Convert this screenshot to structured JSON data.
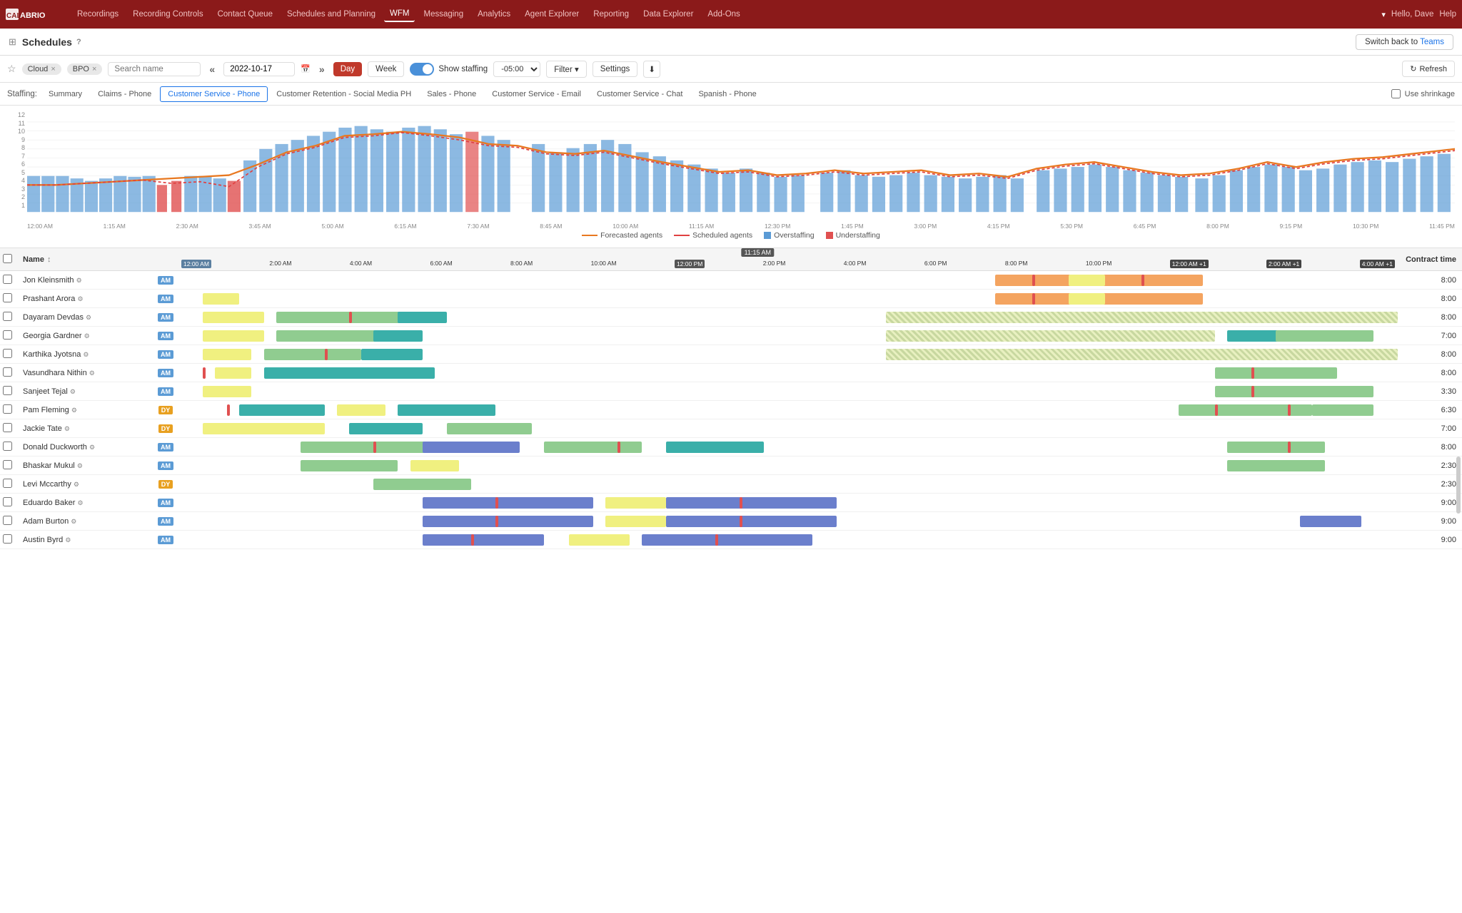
{
  "app": {
    "logo": "CALABRIO",
    "nav_items": [
      {
        "label": "Recordings",
        "active": false
      },
      {
        "label": "Recording Controls",
        "active": false
      },
      {
        "label": "Contact Queue",
        "active": false
      },
      {
        "label": "Schedules and Planning",
        "active": false
      },
      {
        "label": "WFM",
        "active": true
      },
      {
        "label": "Messaging",
        "active": false
      },
      {
        "label": "Analytics",
        "active": false
      },
      {
        "label": "Agent Explorer",
        "active": false
      },
      {
        "label": "Reporting",
        "active": false
      },
      {
        "label": "Data Explorer",
        "active": false
      },
      {
        "label": "Add-Ons",
        "active": false
      }
    ],
    "user": "Hello, Dave",
    "help": "Help",
    "switch_teams": "Switch back to Teams"
  },
  "toolbar": {
    "title": "Schedules",
    "help_icon": "?"
  },
  "filter_bar": {
    "tags": [
      "Cloud",
      "BPO"
    ],
    "search_placeholder": "Search name",
    "date": "2022-10-17",
    "day_label": "Day",
    "week_label": "Week",
    "show_staffing": "Show staffing",
    "timezone": "-05:00",
    "filter_label": "Filter",
    "settings_label": "Settings",
    "refresh_label": "Refresh"
  },
  "staffing": {
    "label": "Staffing:",
    "tabs": [
      {
        "label": "Summary",
        "active": false
      },
      {
        "label": "Claims - Phone",
        "active": false
      },
      {
        "label": "Customer Service - Phone",
        "active": true
      },
      {
        "label": "Customer Retention - Social Media PH",
        "active": false
      },
      {
        "label": "Sales - Phone",
        "active": false
      },
      {
        "label": "Customer Service - Email",
        "active": false
      },
      {
        "label": "Customer Service - Chat",
        "active": false
      },
      {
        "label": "Spanish - Phone",
        "active": false
      }
    ],
    "shrinkage": "Use shrinkage"
  },
  "chart": {
    "y_labels": [
      "1",
      "2",
      "3",
      "4",
      "5",
      "6",
      "7",
      "8",
      "9",
      "10",
      "11",
      "12"
    ],
    "x_labels": [
      "12:00 AM",
      "1:15 AM",
      "2:30 AM",
      "3:45 AM",
      "5:00 AM",
      "6:15 AM",
      "7:30 AM",
      "8:45 AM",
      "10:00 AM",
      "11:15 AM",
      "12:30 PM",
      "1:45 PM",
      "3:00 PM",
      "4:15 PM",
      "5:30 PM",
      "6:45 PM",
      "8:00 PM",
      "9:15 PM",
      "10:30 PM",
      "11:45 PM"
    ],
    "legend": [
      {
        "type": "line",
        "color": "#e87820",
        "label": "Forecasted agents"
      },
      {
        "type": "line",
        "color": "#e04040",
        "label": "Scheduled agents"
      },
      {
        "type": "box",
        "color": "#5b9bd5",
        "label": "Overstaffing"
      },
      {
        "type": "box",
        "color": "#e05050",
        "label": "Understaffing"
      }
    ]
  },
  "schedule": {
    "header": {
      "name": "Name",
      "sort_icon": "↕",
      "contract_time": "Contract time",
      "current_time": "11:15 AM"
    },
    "rows": [
      {
        "name": "Jon Kleinsmith",
        "type": "AM",
        "contract": "8:00"
      },
      {
        "name": "Prashant Arora",
        "type": "AM",
        "contract": "8:00"
      },
      {
        "name": "Dayaram Devdas",
        "type": "AM",
        "contract": "8:00"
      },
      {
        "name": "Georgia Gardner",
        "type": "AM",
        "contract": "7:00"
      },
      {
        "name": "Karthika Jyotsna",
        "type": "AM",
        "contract": "8:00"
      },
      {
        "name": "Vasundhara Nithin",
        "type": "AM",
        "contract": "8:00"
      },
      {
        "name": "Sanjeet Tejal",
        "type": "AM",
        "contract": "3:30"
      },
      {
        "name": "Pam Fleming",
        "type": "DY",
        "contract": "6:30"
      },
      {
        "name": "Jackie Tate",
        "type": "DY",
        "contract": "7:00"
      },
      {
        "name": "Donald Duckworth",
        "type": "AM",
        "contract": "8:00"
      },
      {
        "name": "Bhaskar Mukul",
        "type": "AM",
        "contract": "2:30"
      },
      {
        "name": "Levi Mccarthy",
        "type": "DY",
        "contract": "2:30"
      },
      {
        "name": "Eduardo Baker",
        "type": "AM",
        "contract": "9:00"
      },
      {
        "name": "Adam Burton",
        "type": "AM",
        "contract": "9:00"
      },
      {
        "name": "Austin Byrd",
        "type": "AM",
        "contract": "9:00"
      }
    ],
    "time_labels": [
      "12:00 AM",
      "2:00 AM",
      "4:00 AM",
      "6:00 AM",
      "8:00 AM",
      "10:00 AM",
      "12:00 PM",
      "2:00 PM",
      "4:00 PM",
      "6:00 PM",
      "8:00 PM",
      "10:00 PM",
      "12:00 AM +1",
      "2:00 AM +1",
      "4:00 AM +1"
    ]
  }
}
